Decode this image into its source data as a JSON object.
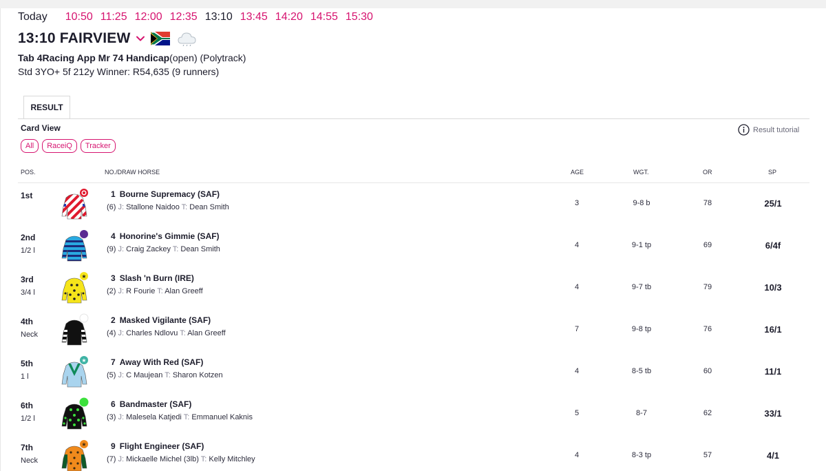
{
  "nav": {
    "today": "Today",
    "times": [
      "10:50",
      "11:25",
      "12:00",
      "12:35",
      "13:10",
      "13:45",
      "14:20",
      "14:55",
      "15:30"
    ],
    "active_time": "13:10"
  },
  "race": {
    "title": "13:10 FAIRVIEW",
    "name_bold": "Tab 4Racing App Mr 74 Handicap",
    "name_rest": "(open) (Polytrack)",
    "info": "Std 3YO+ 5f 212y Winner: R54,635 (9 runners)",
    "flag_icon": "south-africa-flag-icon",
    "weather_icon": "cloud-icon"
  },
  "tabs": {
    "result": "RESULT"
  },
  "card_view": {
    "label": "Card View",
    "filters": [
      "All",
      "RaceiQ",
      "Tracker"
    ]
  },
  "tutorial": {
    "label": "Result tutorial"
  },
  "columns": {
    "pos": "POS.",
    "horse": "NO./DRAW HORSE",
    "age": "AGE",
    "wgt": "WGT.",
    "or": "OR",
    "sp": "SP"
  },
  "jockey_label": "J:",
  "trainer_label": "T:",
  "colors": {
    "accent": "#d6136f",
    "text": "#1c1c2b"
  },
  "runners": [
    {
      "pos": "1st",
      "dist": "",
      "num": "1",
      "horse": "Bourne Supremacy (SAF)",
      "draw": "(6)",
      "jockey": "Stallone Naidoo",
      "trainer": "Dean Smith",
      "age": "3",
      "wgt": "9-8 b",
      "or": "78",
      "sp": "25/1"
    },
    {
      "pos": "2nd",
      "dist": "1/2 l",
      "num": "4",
      "horse": "Honorine's Gimmie (SAF)",
      "draw": "(9)",
      "jockey": "Craig Zackey",
      "trainer": "Dean Smith",
      "age": "4",
      "wgt": "9-1 tp",
      "or": "69",
      "sp": "6/4f"
    },
    {
      "pos": "3rd",
      "dist": "3/4 l",
      "num": "3",
      "horse": "Slash 'n Burn (IRE)",
      "draw": "(2)",
      "jockey": "R Fourie",
      "trainer": "Alan Greeff",
      "age": "4",
      "wgt": "9-7 tb",
      "or": "79",
      "sp": "10/3"
    },
    {
      "pos": "4th",
      "dist": "Neck",
      "num": "2",
      "horse": "Masked Vigilante (SAF)",
      "draw": "(4)",
      "jockey": "Charles Ndlovu",
      "trainer": "Alan Greeff",
      "age": "7",
      "wgt": "9-8 tp",
      "or": "76",
      "sp": "16/1"
    },
    {
      "pos": "5th",
      "dist": "1 l",
      "num": "7",
      "horse": "Away With Red (SAF)",
      "draw": "(5)",
      "jockey": "C Maujean",
      "trainer": "Sharon Kotzen",
      "age": "4",
      "wgt": "8-5 tb",
      "or": "60",
      "sp": "11/1"
    },
    {
      "pos": "6th",
      "dist": "1/2 l",
      "num": "6",
      "horse": "Bandmaster (SAF)",
      "draw": "(3)",
      "jockey": "Malesela Katjedi",
      "trainer": "Emmanuel Kaknis",
      "age": "5",
      "wgt": "8-7",
      "or": "62",
      "sp": "33/1"
    },
    {
      "pos": "7th",
      "dist": "Neck",
      "num": "9",
      "horse": "Flight Engineer (SAF)",
      "draw": "(7)",
      "jockey": "Mickaelle Michel (3lb)",
      "trainer": "Kelly Mitchley",
      "age": "4",
      "wgt": "8-3 tp",
      "or": "57",
      "sp": "4/1"
    }
  ]
}
